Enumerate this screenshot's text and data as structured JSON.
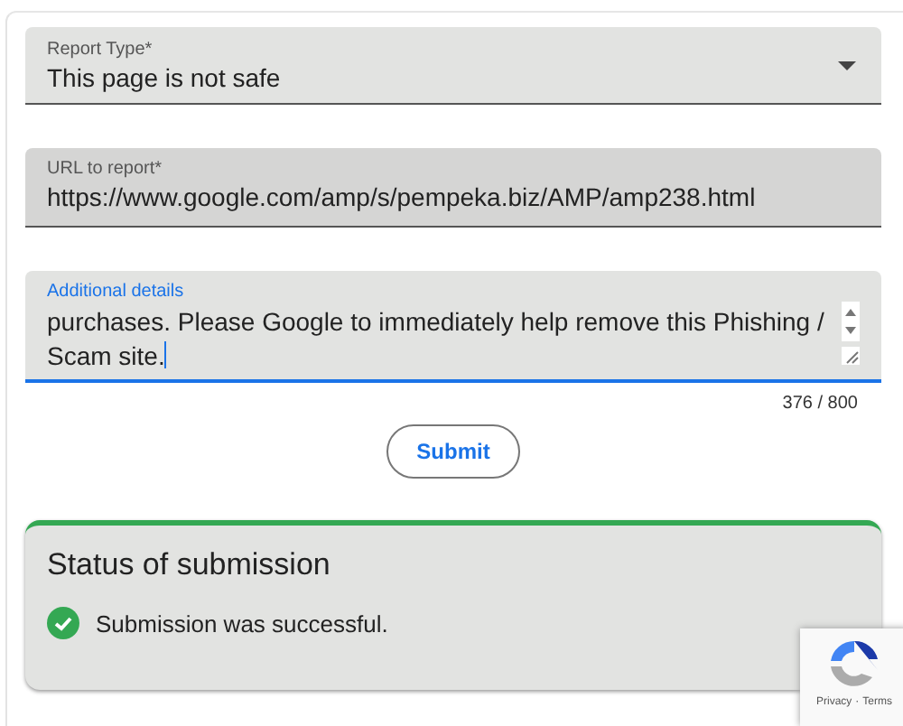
{
  "report_type": {
    "label": "Report Type*",
    "value": "This page is not safe"
  },
  "url_field": {
    "label": "URL to report*",
    "value": "https://www.google.com/amp/s/pempeka.biz/AMP/amp238.html"
  },
  "details_field": {
    "label": "Additional details",
    "value": "purchases. Please Google to immediately help remove this Phishing / Scam site.",
    "focused": true,
    "counter": "376 / 800"
  },
  "submit_button": "Submit",
  "status": {
    "title": "Status of submission",
    "kind": "success",
    "message": "Submission was successful."
  },
  "recaptcha": {
    "links": [
      "Privacy",
      "Terms"
    ],
    "separator": "·"
  }
}
